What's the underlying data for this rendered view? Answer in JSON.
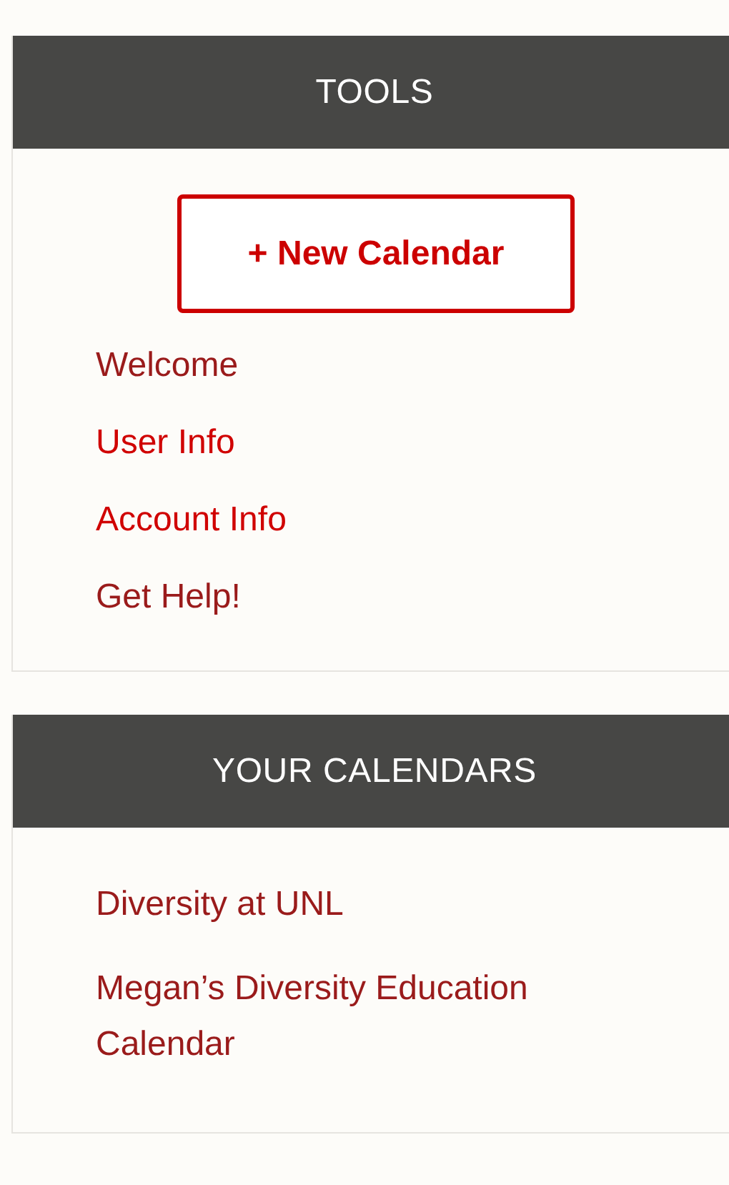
{
  "panels": [
    {
      "title": "TOOLS",
      "button": {
        "label": "+ New Calendar"
      },
      "links": [
        {
          "label": "Welcome",
          "visited": true
        },
        {
          "label": "User Info",
          "visited": false
        },
        {
          "label": "Account Info",
          "visited": false
        },
        {
          "label": "Get Help!",
          "visited": true
        }
      ]
    },
    {
      "title": "YOUR CALENDARS",
      "links": [
        {
          "label": "Diversity at UNL",
          "visited": true
        },
        {
          "label": "Megan’s Diversity Education Calendar",
          "visited": true
        }
      ]
    }
  ]
}
